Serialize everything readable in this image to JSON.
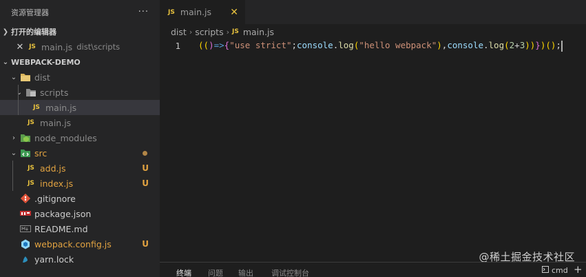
{
  "explorer": {
    "title": "资源管理器",
    "more": "···"
  },
  "open_editors": {
    "title": "打开的编辑器",
    "items": [
      {
        "name": "main.js",
        "path": "dist\\scripts",
        "icon_text": "JS"
      }
    ]
  },
  "workspace": {
    "title": "WEBPACK-DEMO",
    "tree": [
      {
        "name": "dist"
      },
      {
        "name": "scripts"
      },
      {
        "name": "main.js",
        "icon_text": "JS"
      },
      {
        "name": "main.js",
        "icon_text": "JS"
      },
      {
        "name": "node_modules"
      },
      {
        "name": "src"
      },
      {
        "name": "add.js",
        "icon_text": "JS",
        "status": "U"
      },
      {
        "name": "index.js",
        "icon_text": "JS",
        "status": "U"
      },
      {
        "name": ".gitignore"
      },
      {
        "name": "package.json"
      },
      {
        "name": "README.md"
      },
      {
        "name": "webpack.config.js",
        "status": "U"
      },
      {
        "name": "yarn.lock"
      }
    ]
  },
  "editor": {
    "tab": {
      "label": "main.js",
      "icon_text": "JS",
      "close": "✕"
    },
    "breadcrumb": [
      "dist",
      "scripts",
      "main.js"
    ],
    "breadcrumb_icon_text": "JS",
    "line_number": "1",
    "code_tokens": {
      "t1": "((",
      "t2": ")",
      "t3": "=>",
      "t4": "{",
      "t5": "\"use strict\"",
      "t6": ";",
      "t7": "console",
      "t8": ".",
      "t9": "log",
      "t10": "(",
      "t11": "\"hello webpack\"",
      "t12": ")",
      "t13": ",",
      "t14": "console",
      "t15": ".",
      "t16": "log",
      "t17": "(",
      "t18": "2",
      "t19": "+",
      "t20": "3",
      "t21": "))",
      "t22": "}",
      "t23": ")",
      "t24": "()",
      "t25": ";"
    }
  },
  "panel": {
    "tabs": [
      "终端",
      "问题",
      "输出",
      "调试控制台"
    ],
    "terminal_name": "cmd",
    "add": "+"
  },
  "watermark": "@稀土掘金技术社区",
  "colors": {
    "js_icon": "#e8c23e",
    "untracked": "#e2a341",
    "sidebar_bg": "#252526",
    "editor_bg": "#1e1e1e"
  },
  "icons": {
    "folder": "folder-icon",
    "node_modules": "node-folder-icon",
    "src": "src-folder-icon",
    "git": "git-icon",
    "npm": "npm-icon",
    "markdown": "markdown-icon",
    "webpack": "webpack-icon",
    "yarn": "yarn-icon"
  }
}
